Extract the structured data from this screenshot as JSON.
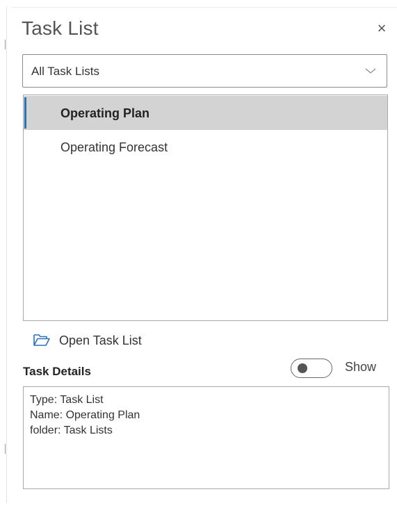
{
  "panel": {
    "title": "Task List",
    "close_symbol": "×",
    "close_icon": "close-icon"
  },
  "dropdown": {
    "selected": "All Task Lists",
    "icon": "chevron-down-icon"
  },
  "task_lists": {
    "items": [
      {
        "label": "Operating Plan",
        "selected": true
      },
      {
        "label": "Operating Forecast",
        "selected": false
      }
    ]
  },
  "open_task_list": {
    "label": "Open Task List",
    "icon": "folder-open-icon"
  },
  "task_details": {
    "title": "Task Details",
    "show_label": "Show",
    "show_toggle_on": false,
    "lines": [
      "Type: Task List",
      "Name: Operating Plan",
      "folder: Task Lists"
    ]
  },
  "colors": {
    "accent": "#2a72b8",
    "selected_row": "#d3d3d3",
    "border": "#a9a9a9"
  }
}
